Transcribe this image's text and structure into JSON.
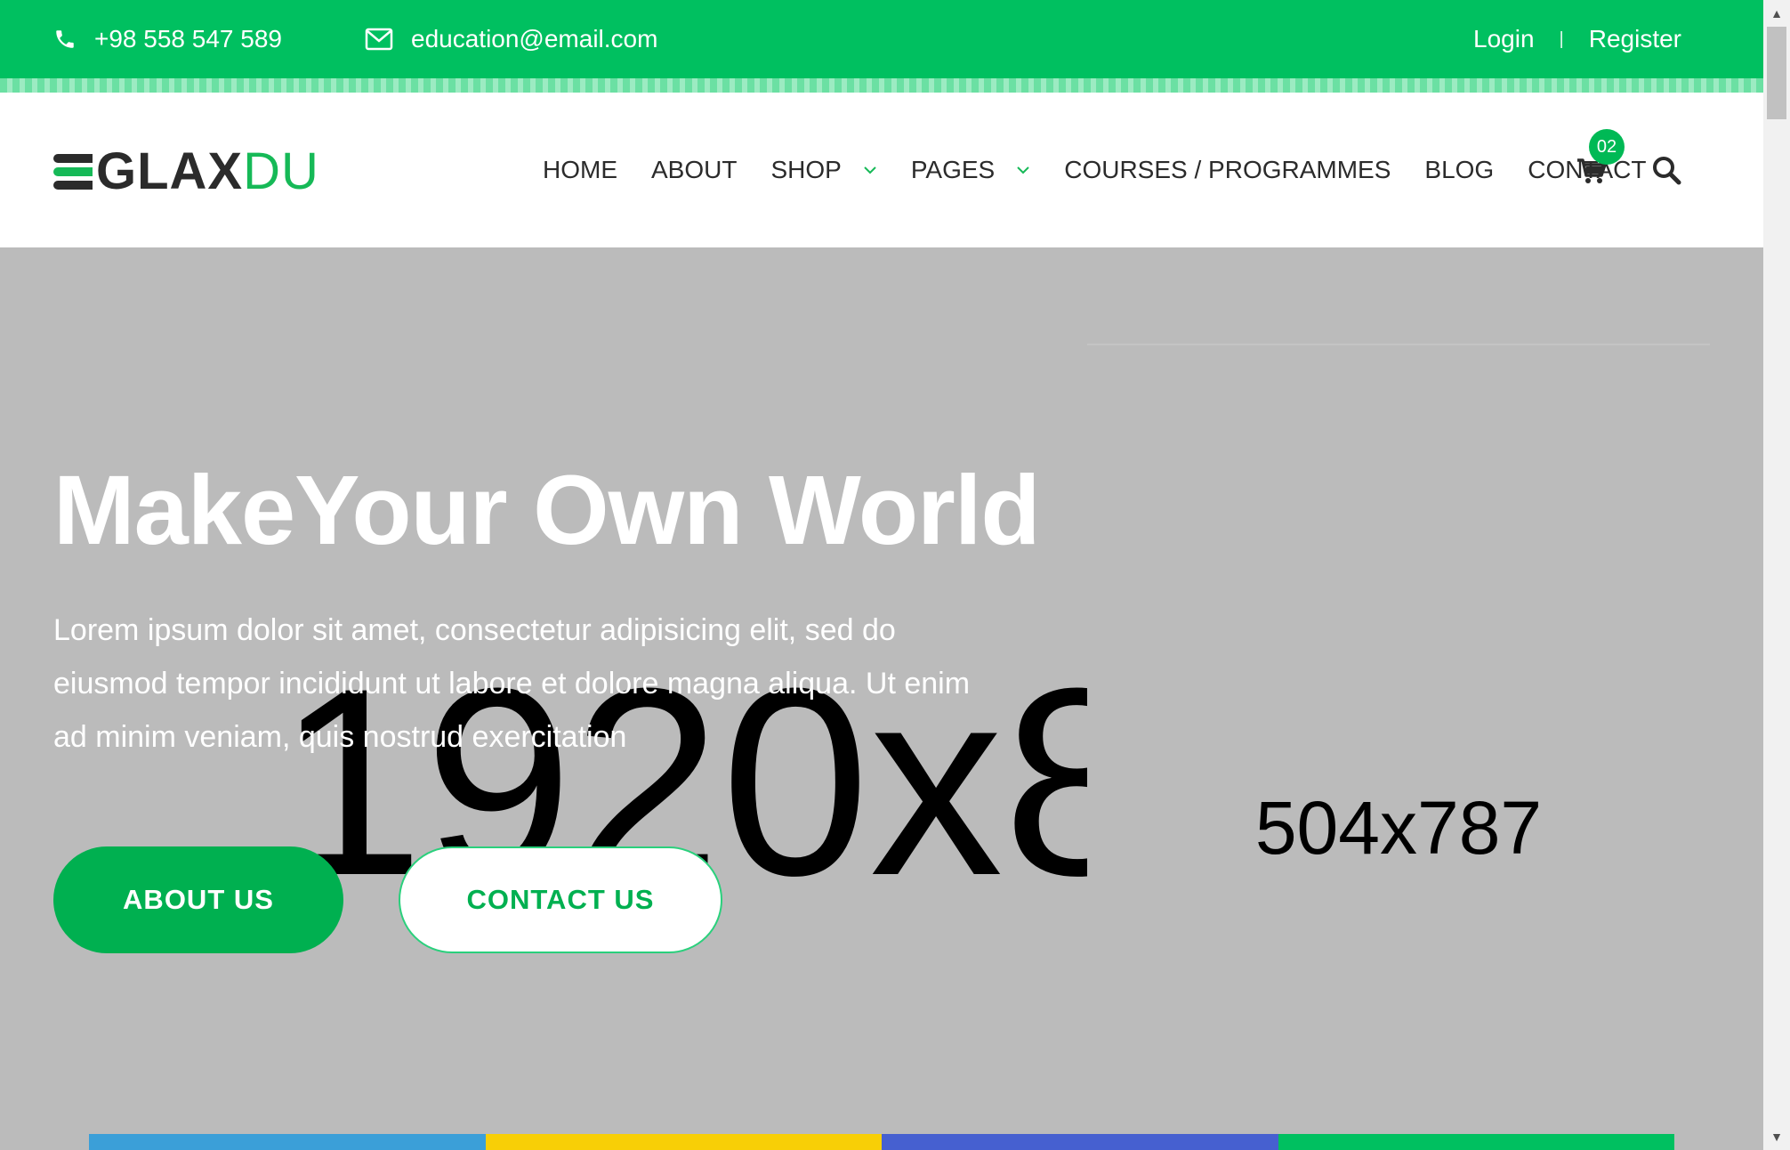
{
  "topbar": {
    "phone": "+98 558 547 589",
    "email": "education@email.com",
    "login": "Login",
    "separator": "|",
    "register": "Register",
    "bg_color": "#00c060"
  },
  "header": {
    "logo": {
      "dark_part": "GLAX",
      "green_part": "DU"
    },
    "nav": [
      {
        "label": "HOME"
      },
      {
        "label": "ABOUT"
      },
      {
        "label": "SHOP"
      },
      {
        "label": "PAGES"
      },
      {
        "label": "COURSES / PROGRAMMES"
      },
      {
        "label": "BLOG"
      },
      {
        "label": "CONTACT"
      }
    ],
    "cart_count": "02"
  },
  "hero": {
    "placeholder_big": "1920x8",
    "placeholder_small": "504x787",
    "title": "MakeYour Own World",
    "text": "Lorem ipsum dolor sit amet, consectetur adipisicing elit, sed do eiusmod tempor incididunt ut labore et dolore magna aliqua. Ut enim ad minim veniam, quis nostrud exercitation",
    "button_primary": "ABOUT US",
    "button_secondary": "CONTACT US",
    "accent_color": "#00b050",
    "color_bar": [
      "#3b9fd8",
      "#f8cf06",
      "#4660d0",
      "#00c060"
    ]
  }
}
